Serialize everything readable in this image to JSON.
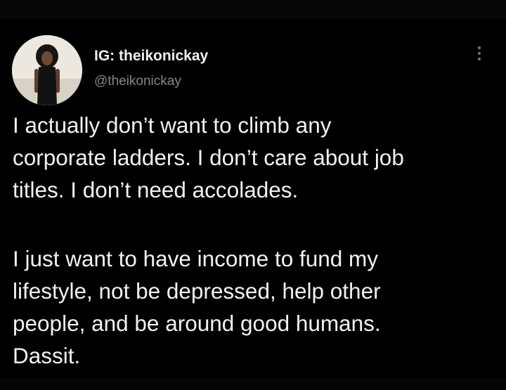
{
  "user": {
    "display_name": "IG: theikonickay",
    "handle": "@theikonickay"
  },
  "tweet": {
    "paragraph1": [
      "I actually don’t want to climb any",
      "corporate ladders. I don’t care about job",
      "titles. I don’t need accolades."
    ],
    "paragraph2": [
      "I just want to have income to fund my",
      "lifestyle, not be depressed, help other",
      "people, and be around good humans.",
      "Dassit."
    ]
  },
  "icons": {
    "more": "more-options-icon",
    "avatar": "profile-avatar"
  },
  "colors": {
    "background": "#000000",
    "text": "#f2f2f2",
    "handle": "#7f8790"
  }
}
